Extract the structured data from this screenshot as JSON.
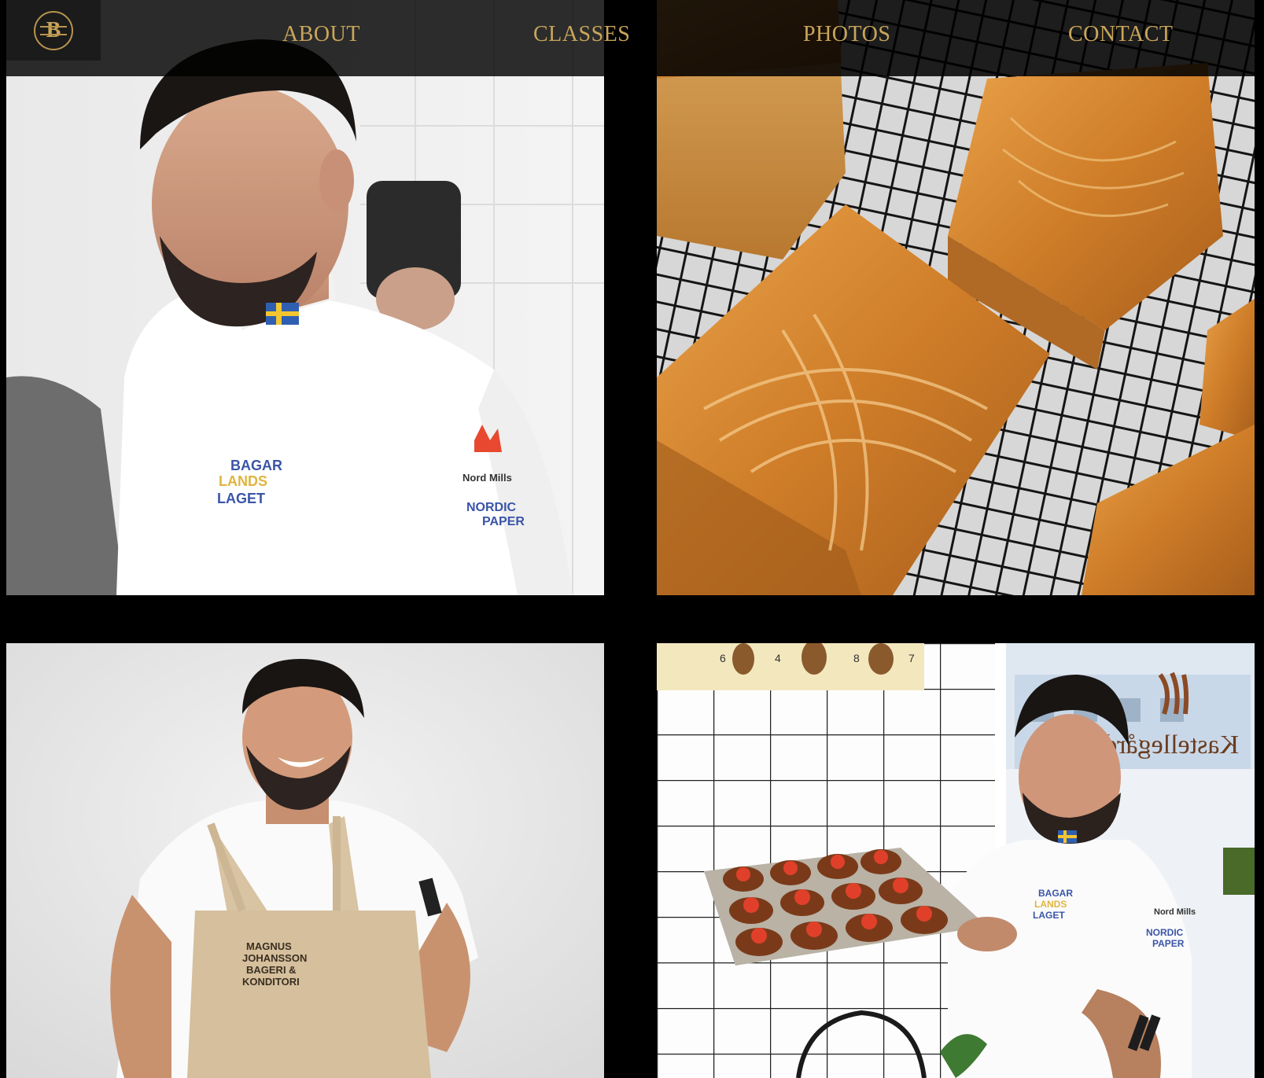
{
  "nav": {
    "logo_letter": "B",
    "items": [
      {
        "label": "ABOUT"
      },
      {
        "label": "CLASSES"
      },
      {
        "label": "PHOTOS"
      },
      {
        "label": "CONTACT"
      }
    ]
  },
  "colors": {
    "background": "#000000",
    "nav_text": "#c9a55a",
    "logo_gold": "#b8954d"
  },
  "gallery": {
    "photos": [
      {
        "subject": "baker-in-white-chef-jacket",
        "patches": [
          "BAGAR LANDS LAGET",
          "Nord Mills",
          "NORDIC PAPER"
        ]
      },
      {
        "subject": "laminated-brioche-cubes-on-cooling-rack"
      },
      {
        "subject": "smiling-baker-in-apron",
        "apron_text": [
          "MAGNUS",
          "JOHANSSON",
          "BAGERI &",
          "KONDITORI"
        ]
      },
      {
        "subject": "baker-with-strawberry-pastries",
        "sign_text": "Kastellegården",
        "patches": [
          "BAGAR LANDS LAGET",
          "Nord Mills",
          "NORDIC PAPER"
        ]
      }
    ]
  }
}
